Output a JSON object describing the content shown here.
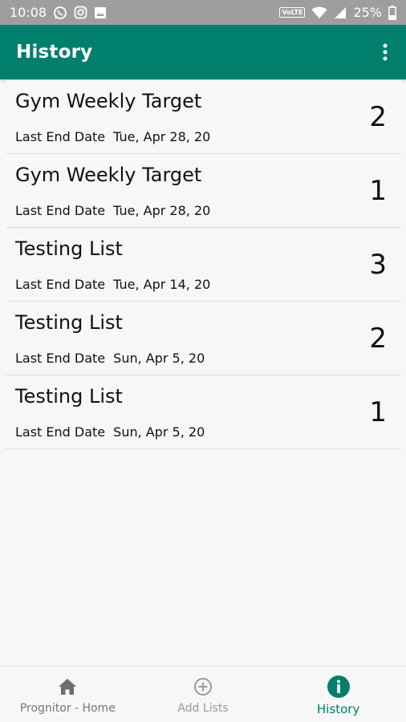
{
  "status_bar": {
    "time": "10:08",
    "volte": "VoLTE",
    "battery": "25%",
    "icons": [
      "whatsapp-icon",
      "instagram-icon",
      "image-icon",
      "volte-icon",
      "wifi-icon",
      "signal-icon",
      "battery-icon"
    ]
  },
  "app_bar": {
    "title": "History",
    "menu_icon": "more-vert-icon"
  },
  "list": {
    "sub_label": "Last End Date",
    "items": [
      {
        "title": "Gym Weekly Target",
        "date": "Tue, Apr 28, 20",
        "count": "2"
      },
      {
        "title": "Gym Weekly Target",
        "date": "Tue, Apr 28, 20",
        "count": "1"
      },
      {
        "title": "Testing List",
        "date": "Tue, Apr 14, 20",
        "count": "3"
      },
      {
        "title": "Testing List",
        "date": "Sun, Apr 5, 20",
        "count": "2"
      },
      {
        "title": "Testing List",
        "date": "Sun, Apr 5, 20",
        "count": "1"
      }
    ]
  },
  "bottom_nav": {
    "items": [
      {
        "label": "Prognitor - Home",
        "icon": "home-icon"
      },
      {
        "label": "Add Lists",
        "icon": "add-circle-icon"
      },
      {
        "label": "History",
        "icon": "info-icon",
        "active": true
      }
    ]
  },
  "colors": {
    "primary": "#00806c",
    "status_bar": "#9e9e9e",
    "background": "#f7f7f7"
  }
}
